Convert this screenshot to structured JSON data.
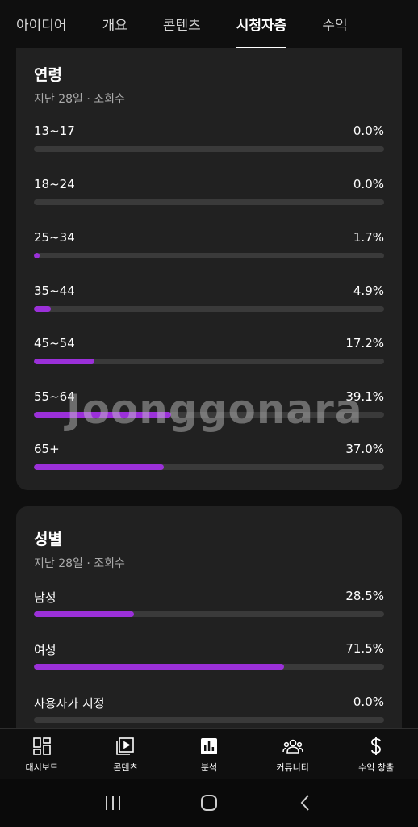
{
  "tabs": [
    {
      "label": "아이디어"
    },
    {
      "label": "개요"
    },
    {
      "label": "콘텐츠"
    },
    {
      "label": "시청자층"
    },
    {
      "label": "수익"
    }
  ],
  "age_card": {
    "title": "연령",
    "subtitle": "지난 28일 · 조회수",
    "rows": [
      {
        "label": "13~17",
        "value": "0.0%",
        "fraction": 0.0
      },
      {
        "label": "18~24",
        "value": "0.0%",
        "fraction": 0.0
      },
      {
        "label": "25~34",
        "value": "1.7%",
        "fraction": 0.017
      },
      {
        "label": "35~44",
        "value": "4.9%",
        "fraction": 0.049
      },
      {
        "label": "45~54",
        "value": "17.2%",
        "fraction": 0.172
      },
      {
        "label": "55~64",
        "value": "39.1%",
        "fraction": 0.391
      },
      {
        "label": "65+",
        "value": "37.0%",
        "fraction": 0.37
      }
    ]
  },
  "gender_card": {
    "title": "성별",
    "subtitle": "지난 28일 · 조회수",
    "rows": [
      {
        "label": "남성",
        "value": "28.5%",
        "fraction": 0.285
      },
      {
        "label": "여성",
        "value": "71.5%",
        "fraction": 0.715
      },
      {
        "label": "사용자가 지정",
        "value": "0.0%",
        "fraction": 0.0
      }
    ]
  },
  "watermark": "Joonggonara",
  "bottom_nav": [
    {
      "label": "대시보드",
      "icon": "dashboard-icon"
    },
    {
      "label": "콘텐츠",
      "icon": "content-icon"
    },
    {
      "label": "분석",
      "icon": "analytics-icon"
    },
    {
      "label": "커뮤니티",
      "icon": "community-icon"
    },
    {
      "label": "수익 창출",
      "icon": "dollar-icon"
    }
  ],
  "colors": {
    "accent": "#9b30d9",
    "card": "#212121",
    "background": "#0f0f0f",
    "track": "#3a3a3a"
  }
}
